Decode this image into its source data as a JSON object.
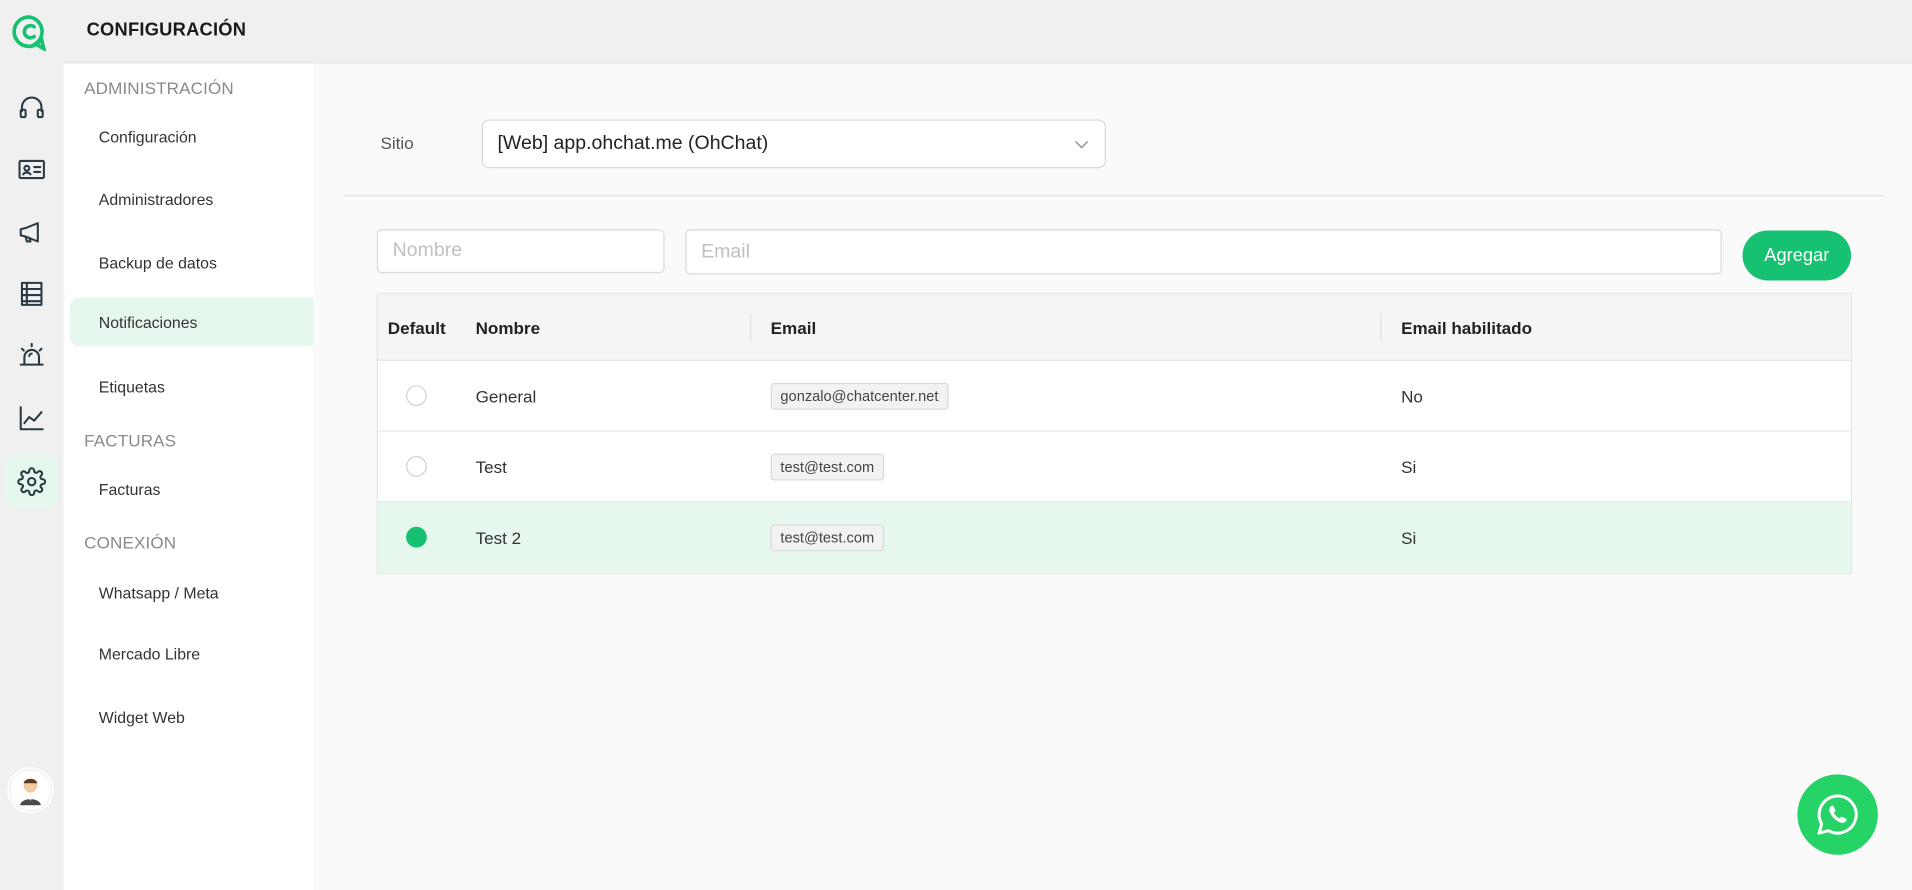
{
  "header": {
    "title": "CONFIGURACIÓN"
  },
  "rail": {
    "icons": [
      "logo-icon",
      "headset-icon",
      "contact-card-icon",
      "megaphone-icon",
      "list-icon",
      "alarm-icon",
      "chart-line-icon",
      "gear-icon"
    ],
    "active": "gear-icon"
  },
  "sidebar": {
    "sections": [
      {
        "title": "ADMINISTRACIÓN",
        "items": [
          "Configuración",
          "Administradores",
          "Backup de datos",
          "Notificaciones",
          "Etiquetas"
        ]
      },
      {
        "title": "FACTURAS",
        "items": [
          "Facturas"
        ]
      },
      {
        "title": "CONEXIÓN",
        "items": [
          "Whatsapp / Meta",
          "Mercado Libre",
          "Widget Web"
        ]
      }
    ],
    "active_item": "Notificaciones"
  },
  "site": {
    "label": "Sitio",
    "value": "[Web] app.ohchat.me (OhChat)"
  },
  "form": {
    "name_placeholder": "Nombre",
    "email_placeholder": "Email",
    "add_label": "Agregar"
  },
  "table": {
    "columns": [
      "Default",
      "Nombre",
      "Email",
      "Email habilitado"
    ],
    "rows": [
      {
        "default": false,
        "name": "General",
        "email": "gonzalo@chatcenter.net",
        "enabled": "No"
      },
      {
        "default": false,
        "name": "Test",
        "email": "test@test.com",
        "enabled": "Si"
      },
      {
        "default": true,
        "name": "Test 2",
        "email": "test@test.com",
        "enabled": "Si"
      }
    ]
  },
  "colors": {
    "accent": "#16c172",
    "active_bg": "#e6f8ee",
    "whatsapp": "#25d366"
  }
}
